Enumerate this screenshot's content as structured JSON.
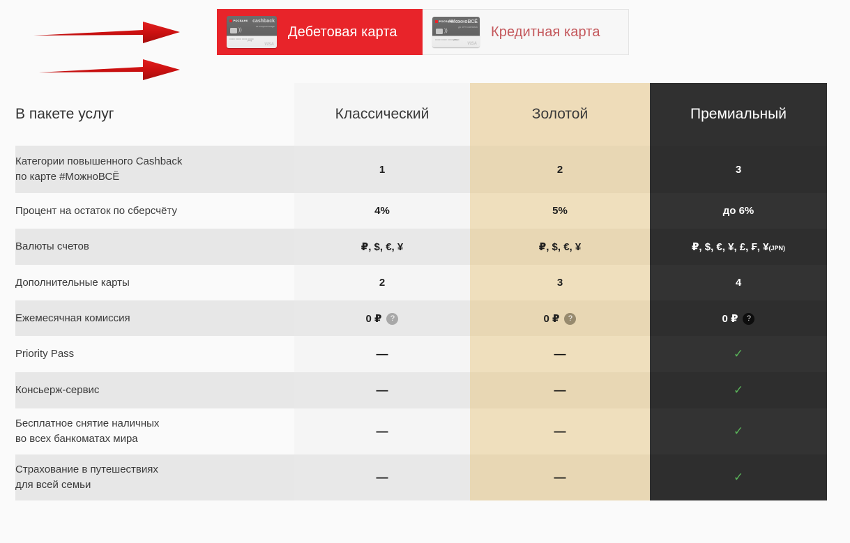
{
  "annotations": {
    "arrow_color": "#cc1111",
    "arrows": [
      {
        "name": "arrow-to-debit-tab"
      },
      {
        "name": "arrow-to-table"
      }
    ]
  },
  "tabs": [
    {
      "id": "debit",
      "label": "Дебетовая карта",
      "active": true,
      "bg": "#e8242a",
      "text_color": "#ffffff",
      "card": {
        "bank": "РОСБАНК",
        "program": "cashback",
        "tagline": "за покупки везде",
        "number": "0000 0000 0000 0000",
        "pay": "pay",
        "scheme": "VISA"
      }
    },
    {
      "id": "credit",
      "label": "Кредитная карта",
      "active": false,
      "bg": "#f7f7f7",
      "text_color": "#c4585c",
      "card": {
        "bank": "РОСБАНК",
        "program": "#МожноВСЁ",
        "tagline": "до 10% cashback",
        "number": "0000 0000 0000 0000",
        "pay": "pay",
        "scheme": "VISA"
      }
    }
  ],
  "table": {
    "header": {
      "feature": "В пакете услуг",
      "columns": [
        {
          "id": "classic",
          "label": "Классический",
          "bg": "#f5f5f5",
          "text_color": "#3b3b3b"
        },
        {
          "id": "gold",
          "label": "Золотой",
          "bg": "#eedcb9",
          "text_color": "#3b3b3b"
        },
        {
          "id": "premium",
          "label": "Премиальный",
          "bg": "#303030",
          "text_color": "#ffffff"
        }
      ]
    },
    "rows": [
      {
        "feature": "Категории повышенного Cashback\nпо карте #МожноВСЁ",
        "classic": "1",
        "gold": "2",
        "premium": "3"
      },
      {
        "feature": "Процент на остаток по сберсчёту",
        "classic": "4%",
        "gold": "5%",
        "premium": "до 6%"
      },
      {
        "feature": "Валюты счетов",
        "classic": "₽, $, €, ¥",
        "gold": "₽, $, €, ¥",
        "premium": "₽, $, €, ¥, £, ₣, ¥",
        "premium_suffix": "(JPN)"
      },
      {
        "feature": "Дополнительные карты",
        "classic": "2",
        "gold": "3",
        "premium": "4"
      },
      {
        "feature": "Ежемесячная комиссия",
        "classic": "0 ₽",
        "gold": "0 ₽",
        "premium": "0 ₽",
        "info_icon": "?"
      },
      {
        "feature": "Priority Pass",
        "classic": "—",
        "gold": "—",
        "premium": "✓"
      },
      {
        "feature": "Консьерж-сервис",
        "classic": "—",
        "gold": "—",
        "premium": "✓"
      },
      {
        "feature": "Бесплатное снятие наличных\nво всех банкоматах мира",
        "classic": "—",
        "gold": "—",
        "premium": "✓"
      },
      {
        "feature": "Страхование в путешествиях\nдля всей семьи",
        "classic": "—",
        "gold": "—",
        "premium": "✓"
      }
    ]
  },
  "colors": {
    "brand_red": "#e8242a",
    "gold": "#eedcb9",
    "premium_dark": "#303030",
    "check_green": "#59b359",
    "arrow_red": "#cc1111"
  }
}
